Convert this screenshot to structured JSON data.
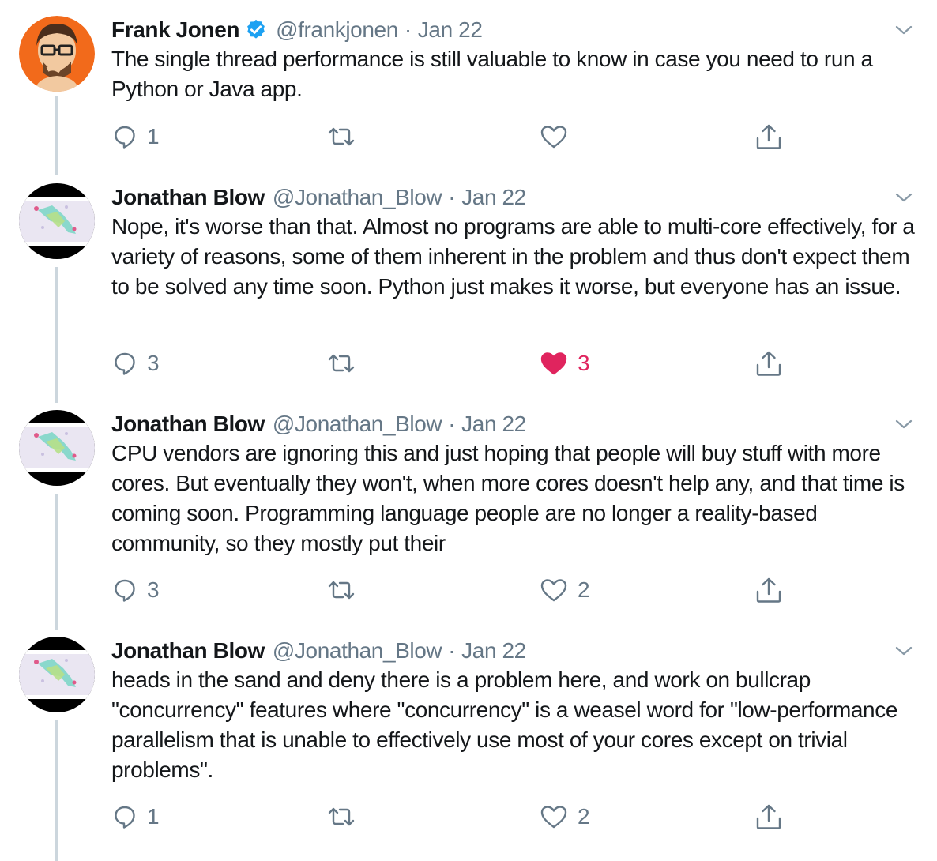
{
  "colors": {
    "text": "#14171a",
    "secondary": "#657786",
    "like_active": "#e0245e",
    "verified": "#1da1f2",
    "thread_line": "#ccd6dd"
  },
  "icons": {
    "reply": "reply-icon",
    "retweet": "retweet-icon",
    "like": "heart-icon",
    "share": "share-icon",
    "more": "chevron-down-icon",
    "verified": "verified-badge-icon"
  },
  "tweets": [
    {
      "display_name": "Frank Jonen",
      "verified": true,
      "handle": "@frankjonen",
      "separator": "·",
      "date": "Jan 22",
      "text": "The single thread performance is still valuable to know in case you need to run a Python or Java app.",
      "replies": "1",
      "retweets": "",
      "likes": "",
      "liked": false
    },
    {
      "display_name": "Jonathan Blow",
      "verified": false,
      "handle": "@Jonathan_Blow",
      "separator": "·",
      "date": "Jan 22",
      "text": "Nope, it's worse than that. Almost no programs are able to multi-core effectively, for a variety of reasons, some of them inherent in the problem and thus don't expect them to be solved any time soon. Python just makes it worse, but everyone has an issue.",
      "replies": "3",
      "retweets": "",
      "likes": "3",
      "liked": true
    },
    {
      "display_name": "Jonathan Blow",
      "verified": false,
      "handle": "@Jonathan_Blow",
      "separator": "·",
      "date": "Jan 22",
      "text": "CPU vendors are ignoring this and just hoping that people will buy stuff with more cores. But eventually they won't, when more cores doesn't help any, and that time is coming soon. Programming language people are no longer a reality-based community, so they mostly put their",
      "replies": "3",
      "retweets": "",
      "likes": "2",
      "liked": false
    },
    {
      "display_name": "Jonathan Blow",
      "verified": false,
      "handle": "@Jonathan_Blow",
      "separator": "·",
      "date": "Jan 22",
      "text": "heads in the sand and deny there is a problem here, and work on bullcrap \"concurrency\" features where \"concurrency\" is a weasel word for \"low-performance parallelism that is unable to effectively use most of your cores except on trivial problems\".",
      "replies": "1",
      "retweets": "",
      "likes": "2",
      "liked": false
    }
  ]
}
